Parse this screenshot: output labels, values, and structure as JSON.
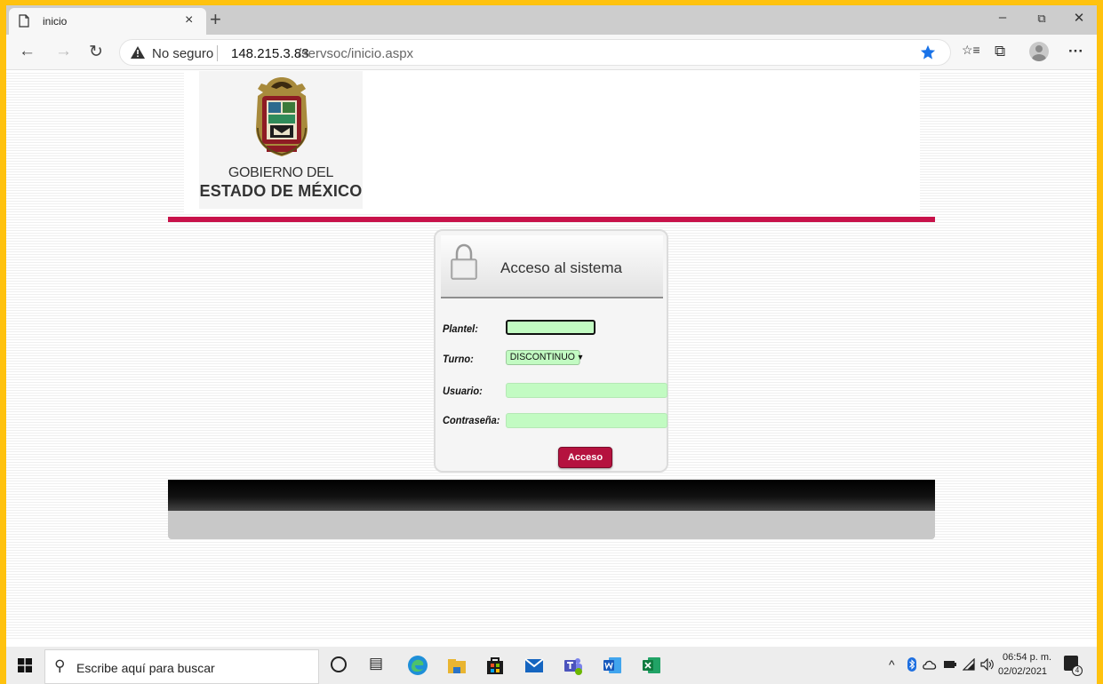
{
  "browser": {
    "tab_title": "inicio",
    "tab_close": "×",
    "new_tab": "+",
    "window_controls": {
      "minimize": "–",
      "restore": "⧉",
      "close": "✕"
    },
    "nav": {
      "back": "←",
      "forward": "→",
      "reload": "↻"
    },
    "security_label": "No seguro",
    "url_host": "148.215.3.83",
    "url_path": "/servsoc/inicio.aspx",
    "icons": [
      "page-icon",
      "warning-icon",
      "star-icon",
      "favorites-icon",
      "collections-icon",
      "profile-icon",
      "more-icon"
    ],
    "favorites_glyph": "☆≡",
    "collections_glyph": "⧉",
    "more_glyph": "···",
    "accent_color": "#1A73E8"
  },
  "header": {
    "gov_line1": "GOBIERNO DEL",
    "gov_line2": "ESTADO DE MÉXICO",
    "accent_bar_color": "#C8124A"
  },
  "login": {
    "title": "Acceso al sistema",
    "plantel_label": "Plantel:",
    "plantel_value": "",
    "turno_label": "Turno:",
    "turno_selected": "DISCONTINUO",
    "usuario_label": "Usuario:",
    "usuario_value": "",
    "password_label": "Contraseña:",
    "password_value": "",
    "submit_label": "Acceso",
    "input_color": "#C2FBC2",
    "button_color": "#B5123F"
  },
  "taskbar": {
    "search_placeholder": "Escribe aquí para buscar",
    "pinned_apps": [
      "edge",
      "file-explorer",
      "store",
      "mail",
      "teams",
      "word",
      "excel"
    ],
    "tray_chevron": "^",
    "clock_time": "06:54 p. m.",
    "clock_date": "02/02/2021",
    "notification_count": "4"
  }
}
